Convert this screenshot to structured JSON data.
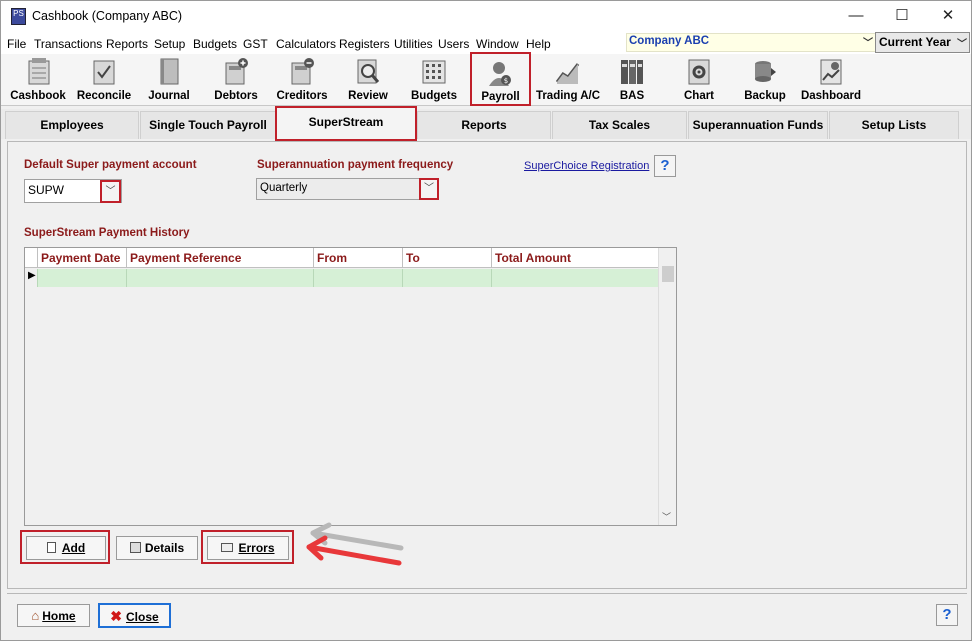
{
  "window": {
    "title": "Cashbook (Company ABC)",
    "app_icon": "PS"
  },
  "menubar": {
    "items": [
      "File",
      "Transactions",
      "Reports",
      "Setup",
      "Budgets",
      "GST",
      "Calculators",
      "Registers",
      "Utilities",
      "Users",
      "Window",
      "Help"
    ],
    "company": "Company ABC",
    "year": "Current Year"
  },
  "toolbar": {
    "items": [
      "Cashbook",
      "Reconcile",
      "Journal",
      "Debtors",
      "Creditors",
      "Review",
      "Budgets",
      "Payroll",
      "Trading A/C",
      "BAS",
      "Chart",
      "Backup",
      "Dashboard"
    ]
  },
  "tabs": [
    "Employees",
    "Single Touch Payroll",
    "SuperStream",
    "Reports",
    "Tax Scales",
    "Superannuation Funds",
    "Setup Lists"
  ],
  "form": {
    "default_account_label": "Default Super payment account",
    "default_account_value": "SUPW",
    "frequency_label": "Superannuation payment frequency",
    "frequency_value": "Quarterly",
    "registration_link": "SuperChoice Registration",
    "history_label": "SuperStream Payment History",
    "columns": [
      "Payment Date",
      "Payment Reference",
      "From",
      "To",
      "Total Amount"
    ]
  },
  "buttons": {
    "add": "Add",
    "details": "Details",
    "errors": "Errors",
    "home": "Home",
    "close": "Close"
  },
  "colors": {
    "highlight": "#c0202a",
    "label": "#8b1a1a",
    "row": "#d6f0d6"
  }
}
